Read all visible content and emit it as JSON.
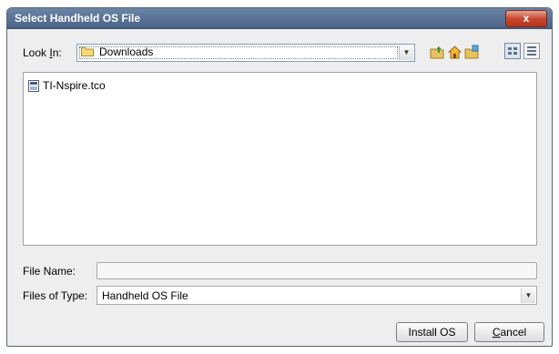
{
  "window": {
    "title": "Select Handheld OS File",
    "close_label": "x"
  },
  "look_in": {
    "label_pre": "Look ",
    "label_mnemonic": "I",
    "label_post": "n:",
    "value": "Downloads",
    "icon": "folder-icon"
  },
  "toolbar": {
    "icons": [
      "up-one-level-icon",
      "home-icon",
      "new-folder-icon",
      "list-view-icon",
      "details-view-icon"
    ]
  },
  "files": [
    {
      "name": "TI-Nspire.tco",
      "icon": "os-file-icon"
    }
  ],
  "file_name": {
    "label": "File Name:",
    "value": ""
  },
  "file_type": {
    "label": "Files of Type:",
    "value": "Handheld OS File"
  },
  "buttons": {
    "install_label": "Install OS",
    "cancel_mnemonic": "C",
    "cancel_rest": "ancel"
  },
  "colors": {
    "title_bar": "#4b6386",
    "close_button": "#c8482f",
    "dialog_bg": "#eeeeee"
  }
}
